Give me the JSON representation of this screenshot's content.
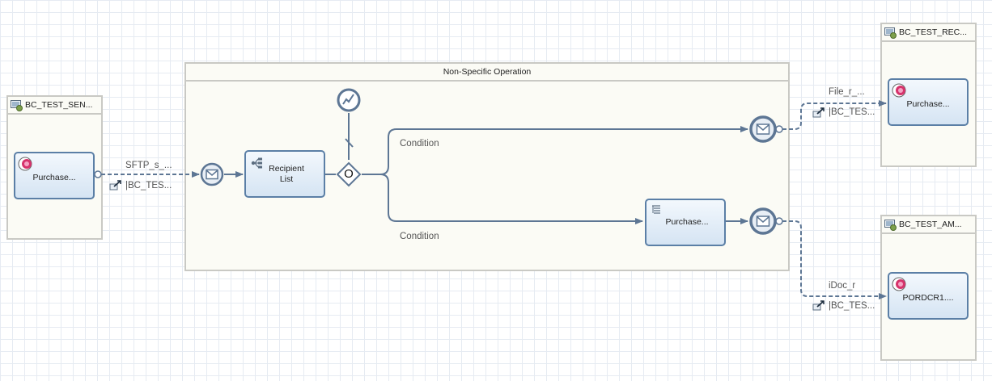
{
  "sender": {
    "title": "BC_TEST_SEN...",
    "component": "Purchase..."
  },
  "operation_pool": {
    "title": "Non-Specific Operation"
  },
  "receivers": [
    {
      "title": "BC_TEST_REC...",
      "component": "Purchase..."
    },
    {
      "title": "BC_TEST_AM...",
      "component": "PORDCR1...."
    }
  ],
  "process": {
    "recipient_list": "Recipient List",
    "gateway_symbol": "O",
    "mapping": "Purchase...",
    "condition_upper": "Condition",
    "condition_lower": "Condition"
  },
  "channels": {
    "sender_adapter": "SFTP_s_...",
    "sender_channel": "|BC_TES...",
    "receiver1_adapter": "File_r_...",
    "receiver1_channel": "|BC_TES...",
    "receiver2_adapter": "iDoc_r",
    "receiver2_channel": "|BC_TES..."
  },
  "colors": {
    "flow": "#5d7694",
    "task_border": "#5b7fa6",
    "pool_border": "#c9c9c4",
    "pool_fill": "#fbfbf5",
    "system_icon": "#d6336c"
  },
  "icons": {
    "system": "system-component-icon",
    "pool": "system-pool-icon",
    "event": "message-event-icon",
    "timer": "timer-event-icon",
    "channel": "channel-link-icon",
    "recipient_list": "recipient-list-icon",
    "mapping": "mapping-icon"
  }
}
